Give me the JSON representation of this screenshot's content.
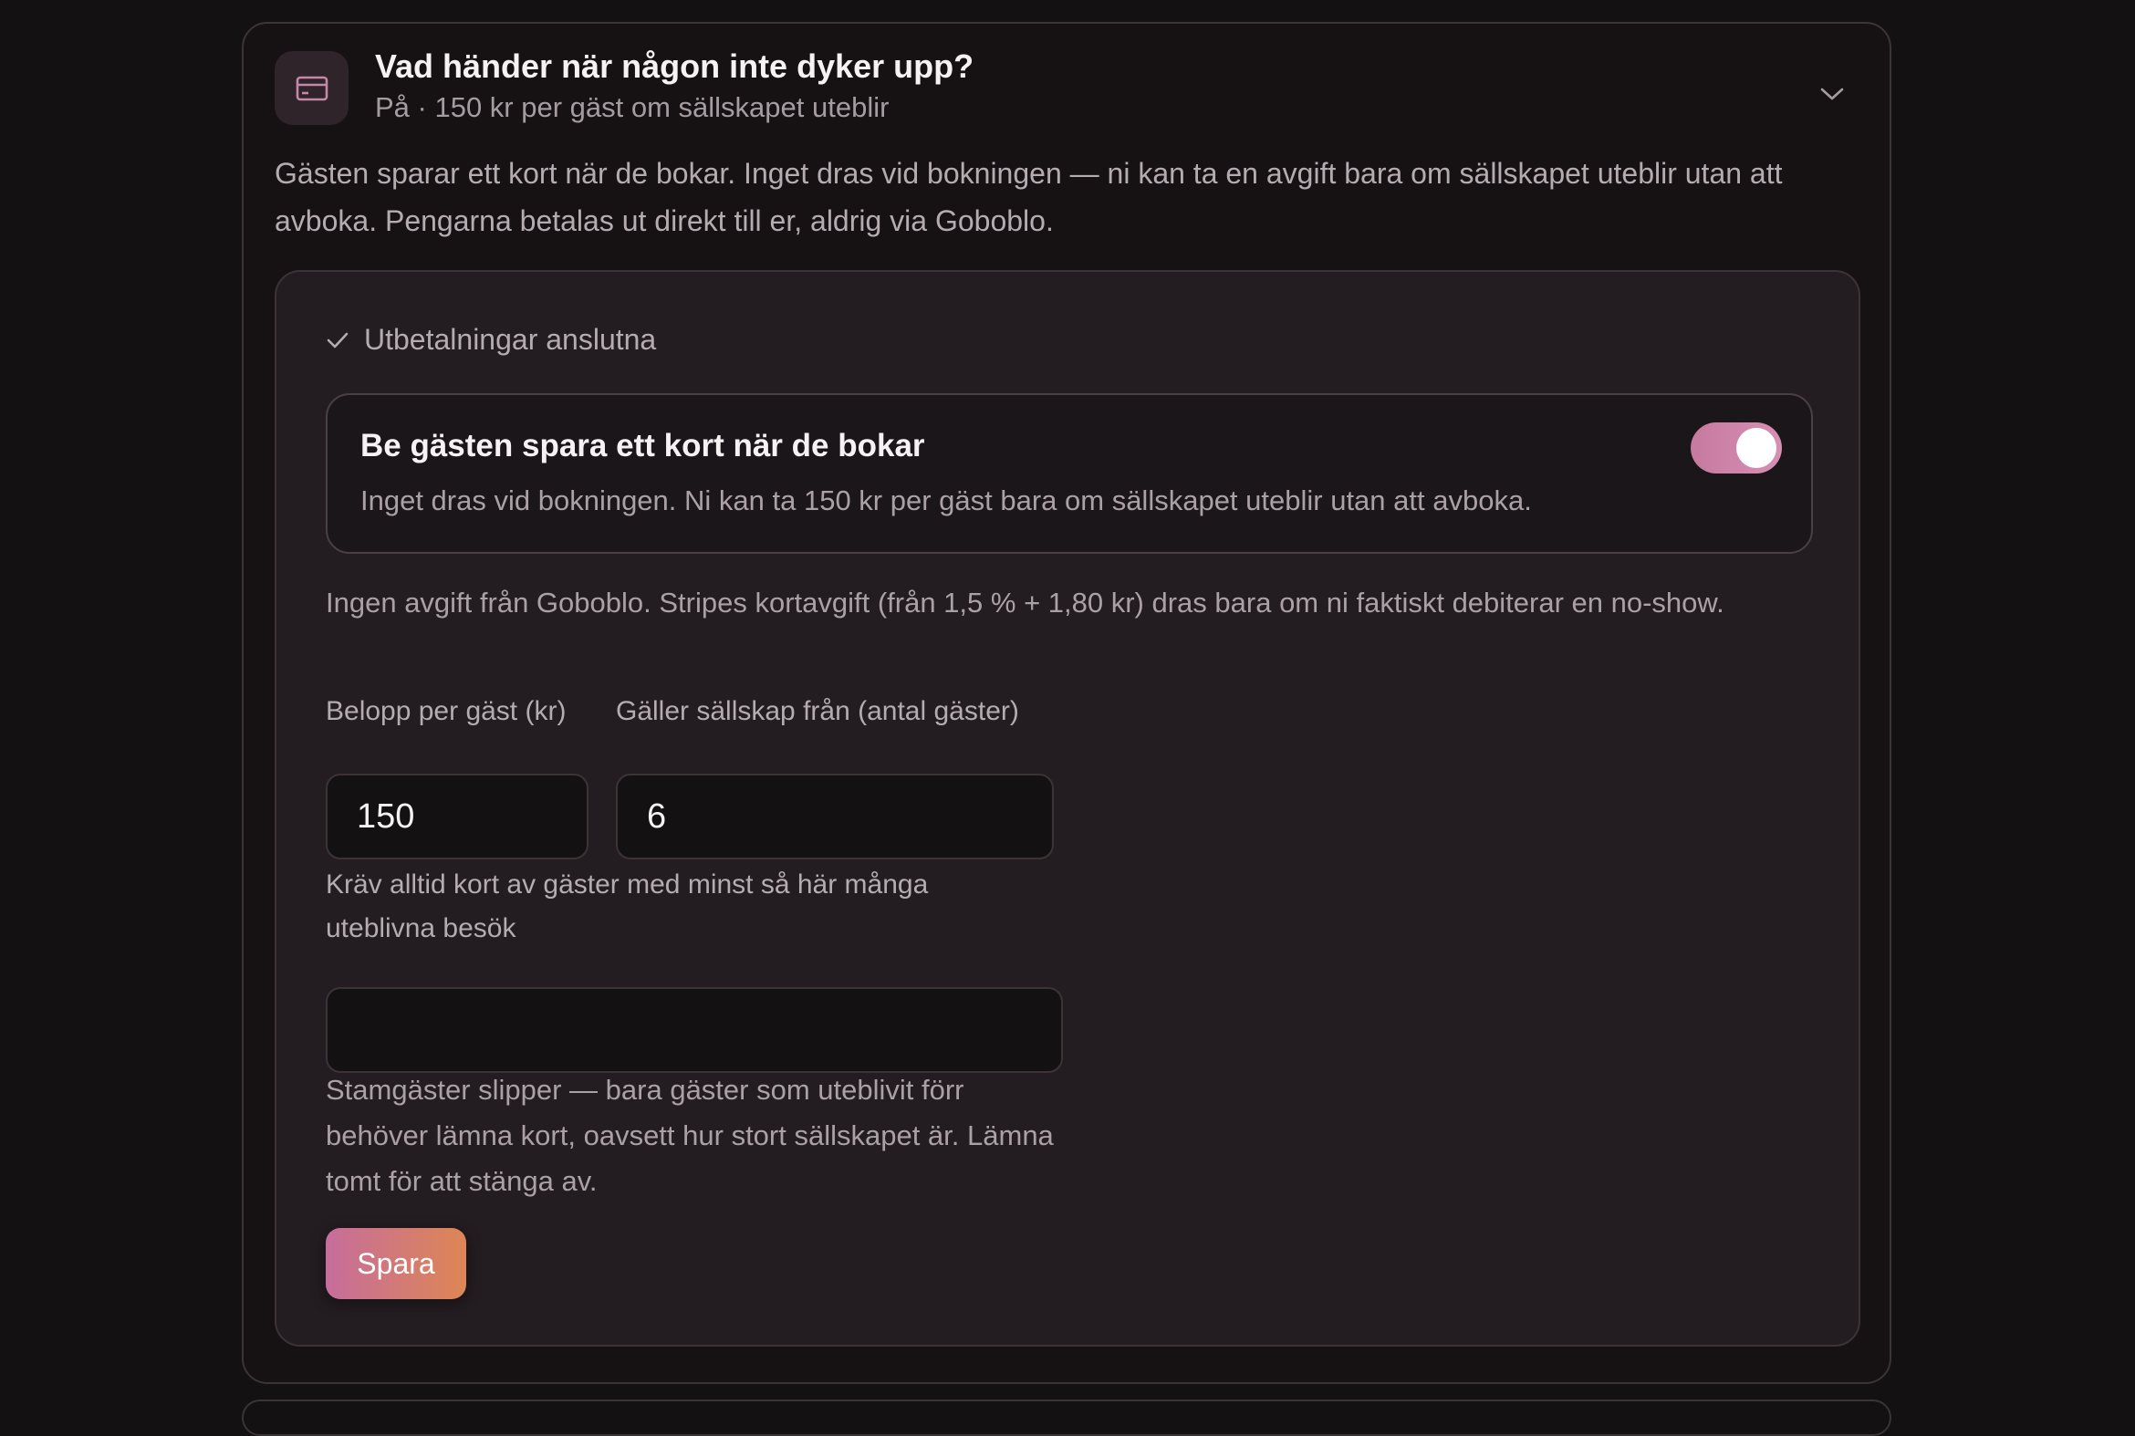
{
  "section": {
    "title": "Vad händer när någon inte dyker upp?",
    "subtitle": "På · 150 kr per gäst om sällskapet uteblir",
    "intro": "Gästen sparar ett kort när de bokar. Inget dras vid bokningen — ni kan ta en avgift bara om sällskapet uteblir utan att avboka. Pengarna betalas ut direkt till er, aldrig via Goboblo.",
    "icons": {
      "header": "credit-card-icon",
      "expand": "chevron-down-icon"
    }
  },
  "panel": {
    "status": "Utbetalningar anslutna",
    "status_icon": "check-icon",
    "toggle": {
      "title": "Be gästen spara ett kort när de bokar",
      "description": "Inget dras vid bokningen. Ni kan ta 150 kr per gäst bara om sällskapet uteblir utan att avboka.",
      "enabled": true
    },
    "fee_note": "Ingen avgift från Goboblo. Stripes kortavgift (från 1,5 % + 1,80 kr) dras bara om ni faktiskt debiterar en no-show.",
    "fields": {
      "amount_label": "Belopp per gäst (kr)",
      "amount_value": "150",
      "party_label": "Gäller sällskap från (antal gäster)",
      "party_value": "6",
      "noshow_label": "Kräv alltid kort av gäster med minst så här många uteblivna besök",
      "noshow_value": "",
      "noshow_help": "Stamgäster slipper — bara gäster som uteblivit förr behöver lämna kort, oavsett hur stort sällskapet är. Lämna tomt för att stänga av."
    },
    "save_label": "Spara",
    "colors": {
      "accent_start": "#c66d9c",
      "accent_end": "#dc8558",
      "toggle_on": "#d088ac"
    }
  }
}
